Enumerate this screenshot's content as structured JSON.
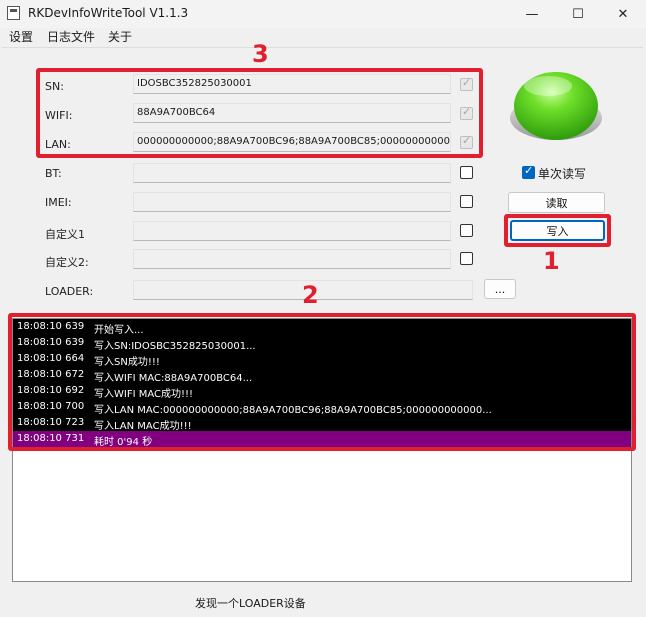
{
  "window": {
    "title": "RKDevInfoWriteTool V1.1.3",
    "minimize_glyph": "—",
    "maximize_glyph": "☐",
    "close_glyph": "✕"
  },
  "menu": {
    "items": [
      "设置",
      "日志文件",
      "关于"
    ]
  },
  "fields": [
    {
      "label": "SN:",
      "value": "IDOSBC352825030001",
      "checked_disabled": true
    },
    {
      "label": "WIFI:",
      "value": "88A9A700BC64",
      "checked_disabled": true
    },
    {
      "label": "LAN:",
      "value": "000000000000;88A9A700BC96;88A9A700BC85;000000000000",
      "checked_disabled": true
    },
    {
      "label": "BT:",
      "value": "",
      "checked_disabled": false
    },
    {
      "label": "IMEI:",
      "value": "",
      "checked_disabled": false
    },
    {
      "label": "自定义1",
      "value": "",
      "checked_disabled": false
    },
    {
      "label": "自定义2:",
      "value": "",
      "checked_disabled": false
    }
  ],
  "loader": {
    "label": "LOADER:",
    "value": "",
    "browse_label": "..."
  },
  "controls": {
    "single_rw_label": "单次读写",
    "single_rw_checked": true,
    "read_label": "读取",
    "write_label": "写入"
  },
  "annotations": {
    "a1": "1",
    "a2": "2",
    "a3": "3"
  },
  "log": [
    {
      "time": "18:08:10 639",
      "msg": "开始写入..."
    },
    {
      "time": "18:08:10 639",
      "msg": "写入SN:IDOSBC352825030001..."
    },
    {
      "time": "18:08:10 664",
      "msg": "写入SN成功!!!"
    },
    {
      "time": "18:08:10 672",
      "msg": "写入WIFI MAC:88A9A700BC64..."
    },
    {
      "time": "18:08:10 692",
      "msg": "写入WIFI MAC成功!!!"
    },
    {
      "time": "18:08:10 700",
      "msg": "写入LAN MAC:000000000000;88A9A700BC96;88A9A700BC85;000000000000..."
    },
    {
      "time": "18:08:10 723",
      "msg": "写入LAN MAC成功!!!"
    },
    {
      "time": "18:08:10 731",
      "msg": "耗时 0'94 秒",
      "highlight": true
    }
  ],
  "status": {
    "text": "发现一个LOADER设备"
  },
  "colors": {
    "accent_red": "#e0202e",
    "highlight_row": "#800080",
    "log_bg": "#000000",
    "status_light": "#46c21a"
  }
}
